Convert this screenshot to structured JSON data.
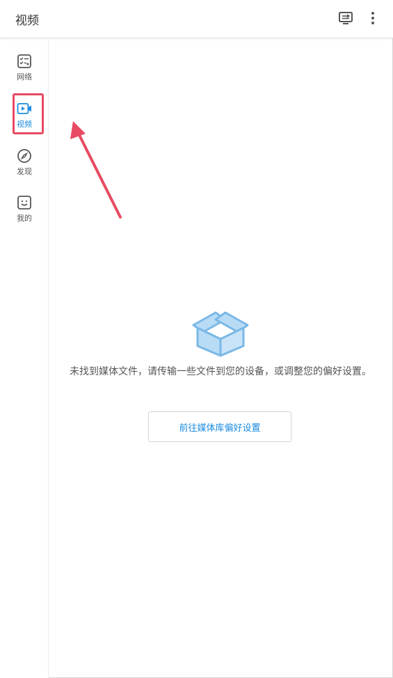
{
  "header": {
    "title": "视频",
    "icons": [
      "cast-screen-icon",
      "more-vertical-icon"
    ]
  },
  "sidebar": {
    "items": [
      {
        "label": "网络",
        "icon": "network-list-icon",
        "active": false
      },
      {
        "label": "视频",
        "icon": "video-icon",
        "active": true
      },
      {
        "label": "发现",
        "icon": "compass-icon",
        "active": false
      },
      {
        "label": "我的",
        "icon": "smiley-face-icon",
        "active": false
      }
    ]
  },
  "main": {
    "empty_icon": "open-box-icon",
    "empty_message": "未找到媒体文件，请传输一些文件到您的设备，或调整您的偏好设置。",
    "goto_button_label": "前往媒体库偏好设置"
  },
  "annotation": {
    "highlight_color": "#e84a63"
  },
  "colors": {
    "accent": "#1a8be0",
    "box_fill": "#b8dcf6",
    "box_stroke": "#7ab8e6"
  }
}
